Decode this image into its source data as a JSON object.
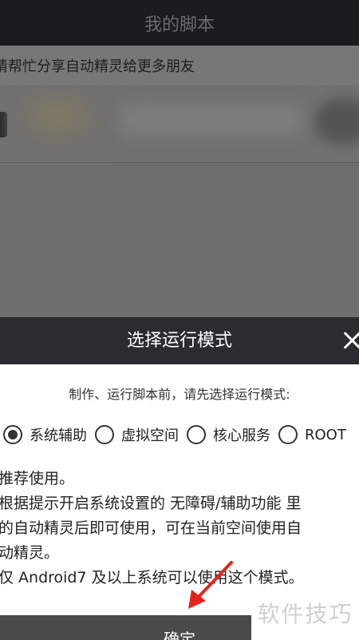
{
  "app": {
    "title": "我的脚本",
    "share_banner": "请帮忙分享自动精灵给更多朋友"
  },
  "dialog": {
    "title": "选择运行模式",
    "prompt": "制作、运行脚本前，请先选择运行模式:",
    "options": [
      {
        "label": "系统辅助",
        "selected": true
      },
      {
        "label": "虚拟空间",
        "selected": false
      },
      {
        "label": "核心服务",
        "selected": false
      },
      {
        "label": "ROOT",
        "selected": false
      }
    ],
    "description": [
      "推荐使用。",
      "根据提示开启系统设置的 无障碍/辅助功能 里",
      "的自动精灵后即可使用，可在当前空间使用自",
      "动精灵。",
      "仅 Android7 及以上系统可以使用这个模式。"
    ],
    "confirm_label": "确定"
  },
  "watermark": "软件技巧",
  "colors": {
    "header_dark": "#2b2b30",
    "overlay": "#6e6e6e",
    "annotation_arrow": "#e8231d"
  }
}
